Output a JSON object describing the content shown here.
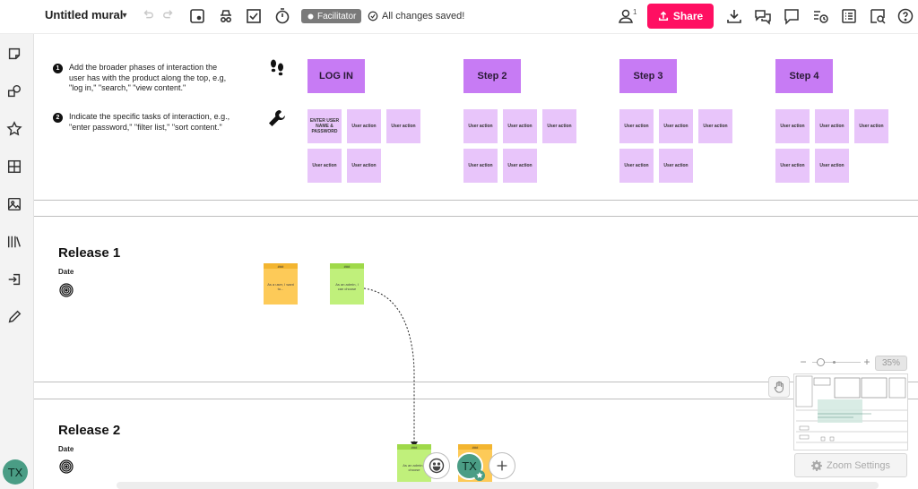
{
  "header": {
    "title": "Untitled mural",
    "title_caret": "▾",
    "undo_icon": "undo-icon",
    "redo_icon": "redo-icon",
    "facilitator_label": "Facilitator",
    "saved_label": "All changes saved!",
    "collaborator_count": "1",
    "share_label": "Share",
    "share_color": "#ff0f62"
  },
  "instructions": {
    "step1": {
      "number": "1",
      "text": "Add the broader phases of interaction the user has with the product along the top, e.g, \"log in,\" \"search,\" \"view content.\""
    },
    "step2": {
      "number": "2",
      "text": "Indicate the specific tasks of interaction, e.g., \"enter password,\" \"filter list,\" \"sort content.\""
    }
  },
  "phases": [
    "LOG IN",
    "Step 2",
    "Step 3",
    "Step 4"
  ],
  "tasks": {
    "first": "ENTER USER NAME & PASSWORD",
    "default": "User action"
  },
  "releases": [
    {
      "title": "Release 1",
      "date_label": "Date",
      "stories": [
        {
          "cap": "###",
          "text": "As a user, I want to...",
          "color": "yellow"
        },
        {
          "cap": "###",
          "text": "As an admin, I can choose",
          "color": "green"
        }
      ]
    },
    {
      "title": "Release 2",
      "date_label": "Date",
      "stories": [
        {
          "cap": "###",
          "text": "As an admin, I choose",
          "color": "green"
        },
        {
          "cap": "###",
          "text": "",
          "color": "yellow"
        }
      ]
    }
  ],
  "user": {
    "initials": "TX",
    "color": "#4a9d85"
  },
  "zoom": {
    "minus": "−",
    "plus": "+",
    "percent": "35%",
    "settings_label": "Zoom Settings"
  },
  "colors": {
    "phase": "#c77bf4",
    "task": "#e8c5fa",
    "sticky_yellow": "#fdca58",
    "sticky_green": "#c0f07b"
  }
}
